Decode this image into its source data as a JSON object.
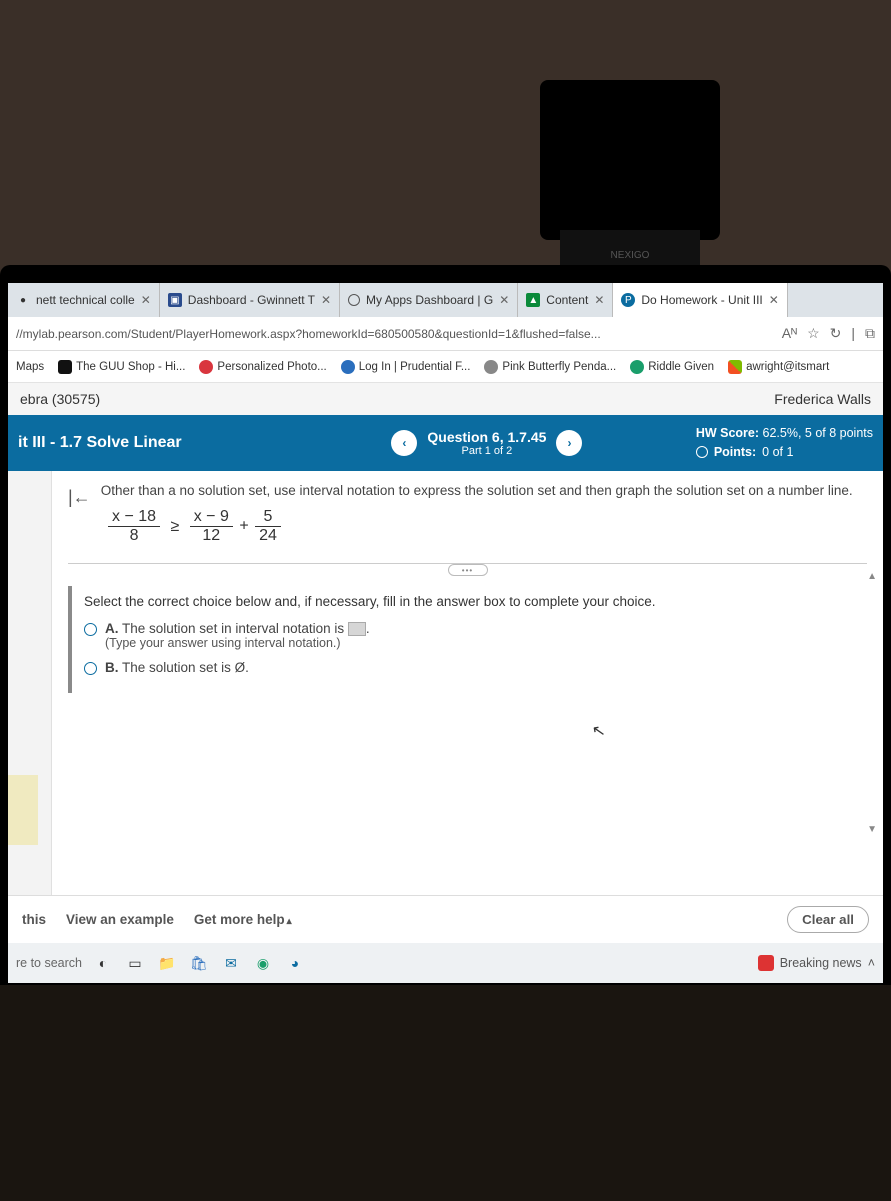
{
  "webcam_brand": "NEXIGO",
  "tabs": [
    {
      "label": "nett technical colle",
      "fav_color": "#888"
    },
    {
      "label": "Dashboard - Gwinnett T",
      "fav_color": "#2a4b8d"
    },
    {
      "label": "My Apps Dashboard | G",
      "fav_color": "#fff"
    },
    {
      "label": "Content",
      "fav_color": "#0a8a3a"
    },
    {
      "label": "Do Homework - Unit III",
      "fav_color": "#0b6ca0",
      "active": true
    }
  ],
  "url": "//mylab.pearson.com/Student/PlayerHomework.aspx?homeworkId=680500580&questionId=1&flushed=false...",
  "url_badges": {
    "reader": "Aᴺ",
    "star": "☆",
    "refresh": "↻",
    "split": "⧉"
  },
  "bookmarks": [
    {
      "label": "Maps",
      "color": "#4285f4"
    },
    {
      "label": "The GUU Shop - Hi...",
      "color": "#111"
    },
    {
      "label": "Personalized Photo...",
      "color": "#d9363e"
    },
    {
      "label": "Log In | Prudential F...",
      "color": "#2a6ebd"
    },
    {
      "label": "Pink Butterfly Penda...",
      "color": "#888"
    },
    {
      "label": "Riddle Given",
      "color": "#1a9e6b"
    },
    {
      "label": "awright@itsmart",
      "color": "#f25022"
    }
  ],
  "course": {
    "name": "ebra (30575)",
    "student": "Frederica Walls"
  },
  "assignment": {
    "title": "it III - 1.7 Solve Linear",
    "question_label": "Question 6, 1.7.45",
    "part_label": "Part 1 of 2",
    "hw_score_label": "HW Score:",
    "hw_score_value": "62.5%, 5 of 8 points",
    "points_label": "Points:",
    "points_value": "0 of 1"
  },
  "question": {
    "prompt": "Other than a no solution set, use interval notation to express the solution set and then graph the solution set on a number line.",
    "lhs_num": "x − 18",
    "lhs_den": "8",
    "op": "≥",
    "r1_num": "x − 9",
    "r1_den": "12",
    "plus": "+",
    "r2_num": "5",
    "r2_den": "24",
    "select_prompt": "Select the correct choice below and, if necessary, fill in the answer box to complete your choice.",
    "choice_a_label": "A.",
    "choice_a_text1": "The solution set in interval notation is ",
    "choice_a_text2": ".",
    "choice_a_hint": "(Type your answer using interval notation.)",
    "choice_b_label": "B.",
    "choice_b_text": "The solution set is Ø."
  },
  "footer": {
    "this": "this",
    "view_example": "View an example",
    "get_help": "Get more help",
    "clear_all": "Clear all"
  },
  "taskbar": {
    "search": "re to search",
    "breaking": "Breaking news"
  }
}
